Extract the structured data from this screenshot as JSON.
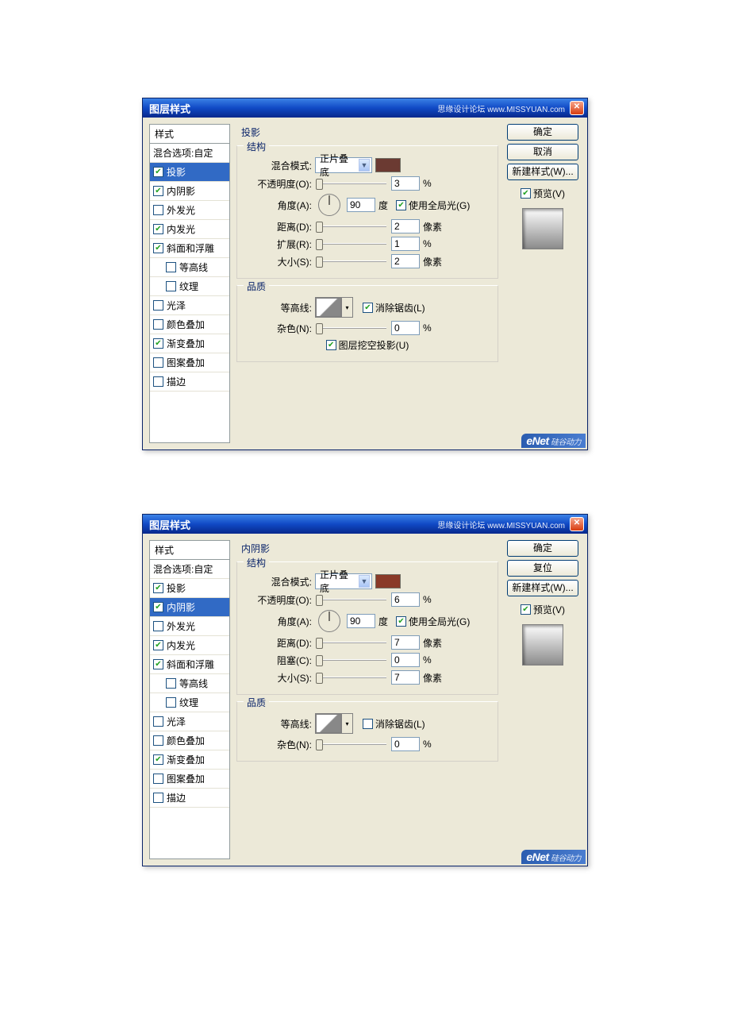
{
  "dialogs": [
    {
      "title": "图层样式",
      "watermark": "思缘设计论坛 www.MISSYUAN.com",
      "stylesHeader": "样式",
      "blendingOptions": "混合选项:自定",
      "styleItems": [
        {
          "label": "投影",
          "checked": true,
          "selected": true
        },
        {
          "label": "内阴影",
          "checked": true
        },
        {
          "label": "外发光",
          "checked": false
        },
        {
          "label": "内发光",
          "checked": true
        },
        {
          "label": "斜面和浮雕",
          "checked": true
        },
        {
          "label": "等高线",
          "checked": false,
          "indent": true
        },
        {
          "label": "纹理",
          "checked": false,
          "indent": true
        },
        {
          "label": "光泽",
          "checked": false
        },
        {
          "label": "颜色叠加",
          "checked": false
        },
        {
          "label": "渐变叠加",
          "checked": true
        },
        {
          "label": "图案叠加",
          "checked": false
        },
        {
          "label": "描边",
          "checked": false
        }
      ],
      "panelTitle": "投影",
      "structure": {
        "legend": "结构",
        "blendModeLabel": "混合模式:",
        "blendMode": "正片叠底",
        "swatch": "#6b3a32",
        "opacityLabel": "不透明度(O):",
        "opacity": "3",
        "opacityUnit": "%",
        "angleLabel": "角度(A):",
        "angle": "90",
        "angleUnit": "度",
        "globalLight": "使用全局光(G)",
        "globalLightChecked": true,
        "distanceLabel": "距离(D):",
        "distance": "2",
        "distanceUnit": "像素",
        "spreadLabel": "扩展(R):",
        "spread": "1",
        "spreadUnit": "%",
        "sizeLabel": "大小(S):",
        "size": "2",
        "sizeUnit": "像素"
      },
      "quality": {
        "legend": "品质",
        "contourLabel": "等高线:",
        "antiAlias": "消除锯齿(L)",
        "antiAliasChecked": true,
        "noiseLabel": "杂色(N):",
        "noise": "0",
        "noiseUnit": "%",
        "knockout": "图层挖空投影(U)",
        "knockoutChecked": true
      },
      "buttons": {
        "ok": "确定",
        "cancel": "取消",
        "newStyle": "新建样式(W)...",
        "preview": "预览(V)",
        "previewChecked": true
      }
    },
    {
      "title": "图层样式",
      "watermark": "思缘设计论坛 www.MISSYUAN.com",
      "stylesHeader": "样式",
      "blendingOptions": "混合选项:自定",
      "styleItems": [
        {
          "label": "投影",
          "checked": true
        },
        {
          "label": "内阴影",
          "checked": true,
          "selected": true
        },
        {
          "label": "外发光",
          "checked": false
        },
        {
          "label": "内发光",
          "checked": true
        },
        {
          "label": "斜面和浮雕",
          "checked": true
        },
        {
          "label": "等高线",
          "checked": false,
          "indent": true
        },
        {
          "label": "纹理",
          "checked": false,
          "indent": true
        },
        {
          "label": "光泽",
          "checked": false
        },
        {
          "label": "颜色叠加",
          "checked": false
        },
        {
          "label": "渐变叠加",
          "checked": true
        },
        {
          "label": "图案叠加",
          "checked": false
        },
        {
          "label": "描边",
          "checked": false
        }
      ],
      "panelTitle": "内阴影",
      "structure": {
        "legend": "结构",
        "blendModeLabel": "混合模式:",
        "blendMode": "正片叠底",
        "swatch": "#8a3a28",
        "opacityLabel": "不透明度(O):",
        "opacity": "6",
        "opacityUnit": "%",
        "angleLabel": "角度(A):",
        "angle": "90",
        "angleUnit": "度",
        "globalLight": "使用全局光(G)",
        "globalLightChecked": true,
        "distanceLabel": "距离(D):",
        "distance": "7",
        "distanceUnit": "像素",
        "spreadLabel": "阻塞(C):",
        "spread": "0",
        "spreadUnit": "%",
        "sizeLabel": "大小(S):",
        "size": "7",
        "sizeUnit": "像素"
      },
      "quality": {
        "legend": "品质",
        "contourLabel": "等高线:",
        "antiAlias": "消除锯齿(L)",
        "antiAliasChecked": false,
        "noiseLabel": "杂色(N):",
        "noise": "0",
        "noiseUnit": "%"
      },
      "buttons": {
        "ok": "确定",
        "cancel": "复位",
        "newStyle": "新建样式(W)...",
        "preview": "预览(V)",
        "previewChecked": true
      }
    }
  ]
}
